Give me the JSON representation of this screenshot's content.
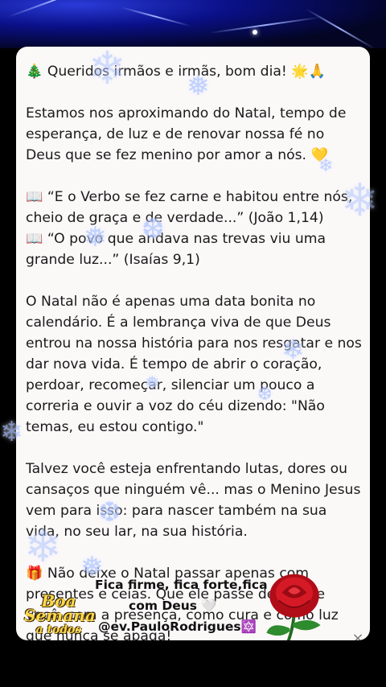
{
  "post": {
    "greeting": "🎄 Queridos irmãos e irmãs, bom dia! 🌟🙏",
    "paragraph1": "Estamos nos aproximando do Natal, tempo de esperança, de luz e de renovar nossa fé no Deus que se fez menino por amor a nós. 💛",
    "verse1": "📖 “E o Verbo se fez carne e habitou entre nós, cheio de graça e de verdade...” (João 1,14)",
    "verse2": "📖 “O povo que andava nas trevas viu uma grande luz...” (Isaías 9,1)",
    "paragraph2": "O Natal não é apenas uma data bonita no calendário. É a lembrança viva de que Deus entrou na nossa história para nos resgatar e nos dar nova vida. É tempo de abrir o coração, perdoar, recomeçar, silenciar um pouco a correria e ouvir a voz do céu dizendo: \"Não temas, eu estou contigo.\"",
    "paragraph3": "Talvez você esteja enfrentando lutas, dores ou cansaços que ninguém vê... mas o Menino Jesus vem para isso: para nascer também na sua vida, no seu lar, na sua história.",
    "paragraph4": "🎁 Não deixe o Natal passar apenas com presentes e ceias. Que ele passe dentro de você, com a presença, como cura e como luz que nunca se apaga!"
  },
  "signature": {
    "line1": "Fica firme, fica forte,fica",
    "line2": "com Deus 🤍",
    "line3": "@ev.PauloRodrigues🔯"
  },
  "sticker": {
    "line1": "Boa",
    "line2": "Semana",
    "line3": "a todos"
  },
  "controls": {
    "close_icon": "×"
  },
  "colors": {
    "card_bg": "#fbf8f8",
    "text": "#1a1a1a",
    "snowflake": "#aec4ff",
    "rose": "#c8101c"
  }
}
